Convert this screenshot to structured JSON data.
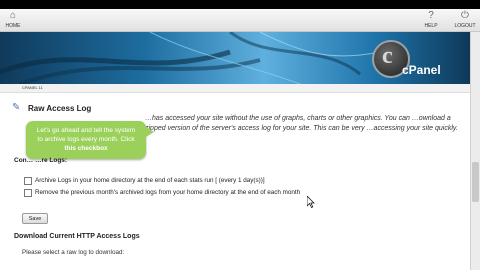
{
  "toolbar": {
    "home_label": "HOME",
    "help_label": "HELP",
    "logout_label": "LOGOUT"
  },
  "banner": {
    "logo_letter": "c",
    "logo_text": "cPanel"
  },
  "breadcrumb": {
    "text": "CPANEL 11"
  },
  "page": {
    "title": "Raw Access Log",
    "description": "…has accessed your site without the use of graphs, charts or other graphics. You can …ownload a zipped version of the server's access log for your site. This can be very …accessing your site quickly."
  },
  "tooltip": {
    "text": "Let's go ahead and tell the system to archive logs every month. Click ",
    "bold": "this checkbox"
  },
  "config": {
    "heading": "Con… …re Logs:",
    "options": [
      {
        "label": "Archive Logs in your home directory at the end of each stats run [ (every 1 day(s))]",
        "checked": false
      },
      {
        "label": "Remove the previous month's archived logs from your home directory at the end of each month",
        "checked": false
      }
    ],
    "save_label": "Save"
  },
  "download": {
    "heading": "Download Current HTTP Access Logs",
    "subtext": "Please select a raw log to download:"
  },
  "colors": {
    "tooltip": "#9bd15a",
    "banner": "#1d6da0"
  },
  "icons": [
    "home-icon",
    "help-icon",
    "logout-icon",
    "document-icon",
    "mouse-cursor-icon"
  ]
}
